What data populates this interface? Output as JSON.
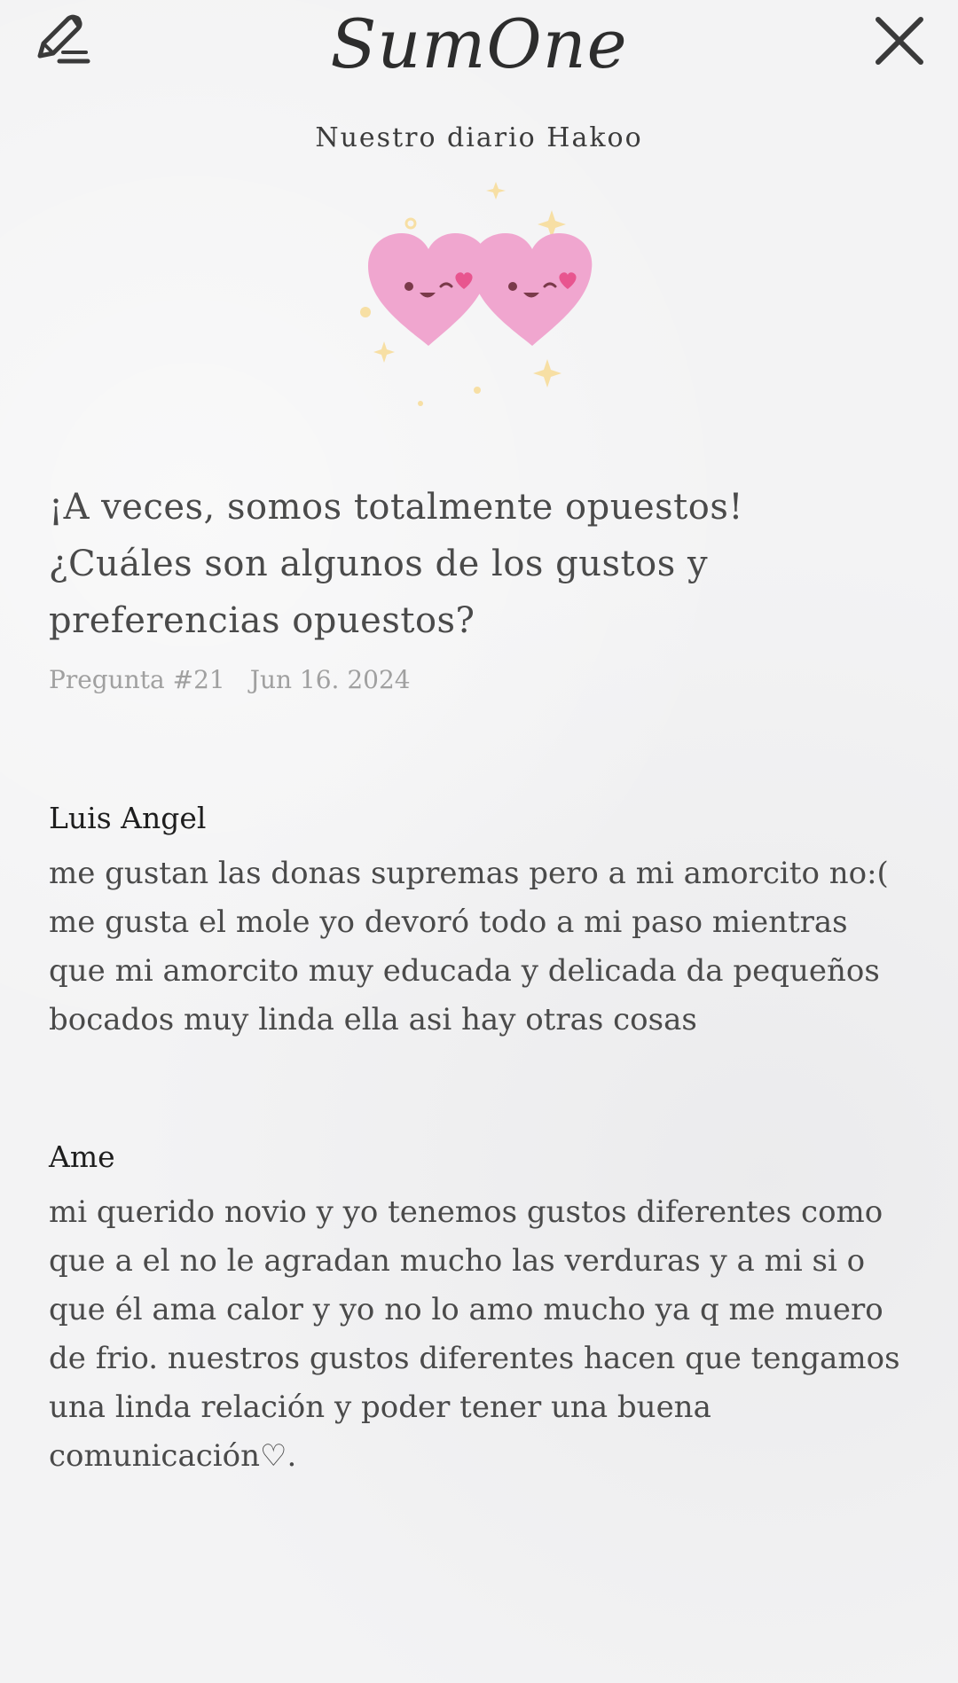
{
  "header": {
    "app_name": "SumOne",
    "edit_icon": "pencil-edit-icon",
    "close_icon": "close-x-icon"
  },
  "diary": {
    "title": "Nuestro diario Hakoo",
    "illustration": "two-hearts-icon"
  },
  "question": {
    "line1": "¡A veces, somos totalmente opuestos!",
    "line2": "¿Cuáles son algunos de los gustos y preferencias opuestos?",
    "number": "Pregunta #21",
    "date": "Jun 16. 2024"
  },
  "answers": [
    {
      "author": "Luis Angel",
      "text": "me gustan las donas supremas pero a mi amorcito no:( me gusta el mole yo devoró todo a mi paso mientras que mi amorcito muy educada y delicada da pequeños bocados muy linda ella asi hay otras cosas"
    },
    {
      "author": "Ame",
      "text": "mi querido novio y yo tenemos gustos diferentes como que a el no le agradan mucho las verduras y a mi si o que él ama calor y yo no lo amo mucho ya q me muero de frio. nuestros gustos diferentes hacen que tengamos una linda relación y poder tener una buena comunicación♡."
    }
  ],
  "colors": {
    "background": "#f3f3f4",
    "heart_pink": "#f0a6cf",
    "sparkle_yellow": "#f7dfa4",
    "meta_gray": "#a0a0a0"
  }
}
